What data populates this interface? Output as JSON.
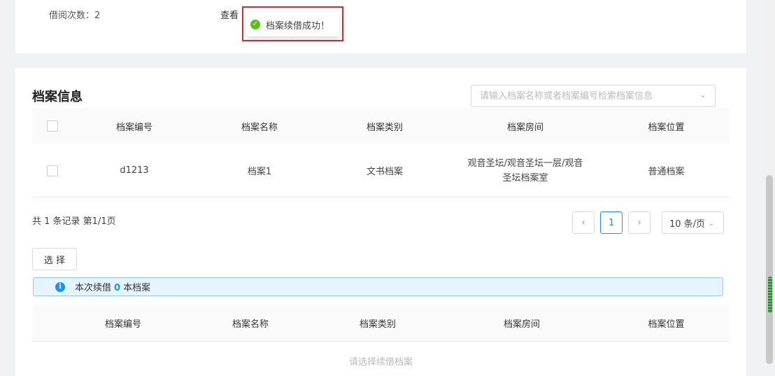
{
  "top": {
    "borrow_count_label": "借阅次数：",
    "borrow_count_value": "2",
    "view_label": "查看"
  },
  "toast": {
    "message": "档案续借成功！",
    "icon": "check-circle-icon",
    "color": "#52c41a"
  },
  "section": {
    "title": "档案信息",
    "search_placeholder": "请输入档案名称或者档案编号检索档案信息"
  },
  "table": {
    "columns": [
      "档案编号",
      "档案名称",
      "档案类别",
      "档案房间",
      "档案位置"
    ],
    "rows": [
      {
        "code": "d1213",
        "name": "档案1",
        "category": "文书档案",
        "room_line1": "观音圣坛/观音圣坛一层/观音",
        "room_line2": "圣坛档案室",
        "location": "普通档案"
      }
    ]
  },
  "pagination": {
    "total_text": "共 1 条记录 第1/1页",
    "prev": "‹",
    "current": "1",
    "next": "›",
    "page_size": "10 条/页"
  },
  "select_button": "选 择",
  "info": {
    "prefix": "本次续借",
    "count": "0",
    "suffix": "本档案",
    "accent": "#1890ff"
  },
  "renew_table": {
    "columns": [
      "档案编号",
      "档案名称",
      "档案类别",
      "档案房间",
      "档案位置"
    ],
    "empty_text": "请选择续借档案"
  }
}
